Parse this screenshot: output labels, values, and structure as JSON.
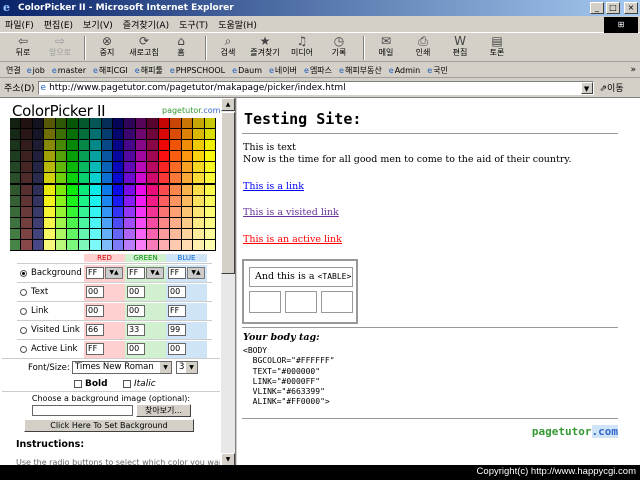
{
  "window": {
    "title": "ColorPicker II - Microsoft Internet Explorer",
    "controls": {
      "min": "_",
      "max": "□",
      "close": "×"
    }
  },
  "menu": [
    "파일(F)",
    "편집(E)",
    "보기(V)",
    "즐겨찾기(A)",
    "도구(T)",
    "도움말(H)"
  ],
  "toolbar": [
    {
      "label": "뒤로",
      "icon": "back-icon",
      "glyph": "⇦",
      "enabled": true
    },
    {
      "label": "앞으로",
      "icon": "forward-icon",
      "glyph": "⇨",
      "enabled": false
    },
    {
      "label": "중지",
      "icon": "stop-icon",
      "glyph": "⊗",
      "enabled": true
    },
    {
      "label": "새로고침",
      "icon": "refresh-icon",
      "glyph": "⟳",
      "enabled": true
    },
    {
      "label": "홈",
      "icon": "home-icon",
      "glyph": "⌂",
      "enabled": true
    },
    {
      "label": "검색",
      "icon": "search-icon",
      "glyph": "⌕",
      "enabled": true
    },
    {
      "label": "즐겨찾기",
      "icon": "favorites-icon",
      "glyph": "★",
      "enabled": true
    },
    {
      "label": "미디어",
      "icon": "media-icon",
      "glyph": "♫",
      "enabled": true
    },
    {
      "label": "기록",
      "icon": "history-icon",
      "glyph": "◷",
      "enabled": true
    },
    {
      "label": "메일",
      "icon": "mail-icon",
      "glyph": "✉",
      "enabled": true
    },
    {
      "label": "인쇄",
      "icon": "print-icon",
      "glyph": "⎙",
      "enabled": true
    },
    {
      "label": "편집",
      "icon": "edit-icon",
      "glyph": "W",
      "enabled": true
    },
    {
      "label": "토론",
      "icon": "discuss-icon",
      "glyph": "▤",
      "enabled": true
    }
  ],
  "links_label": "연결",
  "links": [
    "job",
    "master",
    "해피CGI",
    "해피툴",
    "PHPSCHOOL",
    "Daum",
    "네이버",
    "엠파스",
    "해피부동산",
    "Admin",
    "국민"
  ],
  "links_more": "»",
  "address": {
    "label": "주소(D)",
    "url": "http://www.pagetutor.com/pagetutor/makapage/picker/index.html",
    "go": "⇗이동"
  },
  "picker": {
    "title": "ColorPicker II",
    "brand_a": "pagetutor",
    "brand_b": ".com",
    "headers": {
      "red": "RED",
      "green": "GREEN",
      "blue": "BLUE"
    },
    "rows": [
      {
        "label": "Background",
        "r": "FF",
        "g": "FF",
        "b": "FF",
        "checked": true
      },
      {
        "label": "Text",
        "r": "00",
        "g": "00",
        "b": "00",
        "checked": false
      },
      {
        "label": "Link",
        "r": "00",
        "g": "00",
        "b": "FF",
        "checked": false
      },
      {
        "label": "Visited Link",
        "r": "66",
        "g": "33",
        "b": "99",
        "checked": false
      },
      {
        "label": "Active Link",
        "r": "FF",
        "g": "00",
        "b": "00",
        "checked": false
      }
    ],
    "font_label": "Font/Size:",
    "font_value": "Times New Roman",
    "size_value": "3",
    "bold_label": "Bold",
    "italic_label": "Italic",
    "bg_image_label": "Choose a background image (optional):",
    "browse_label": "찾아보기...",
    "set_bg_label": "Click Here To Set Background",
    "instructions_label": "Instructions:",
    "instructions_text": "Use the radio buttons to select which color you want to change"
  },
  "testing": {
    "title": "Testing Site:",
    "text1": "This is text",
    "text2": "Now is the time for all good men to come to the aid of their country.",
    "link": "This is a link",
    "visited": "This is a visited link",
    "active": "This is an active link",
    "table_text": "And this is a ",
    "table_tag": "<TABLE>",
    "body_heading": "Your body tag:",
    "body_code": "<BODY\n  BGCOLOR=\"#FFFFFF\"\n  TEXT=\"#000000\"\n  LINK=\"#0000FF\"\n  VLINK=\"#663399\"\n  ALINK=\"#FF0000\">",
    "logo_a": "pagetutor",
    "logo_b": ".com"
  },
  "status": {
    "copyright": "Copyright(c) http://www.happycgi.com"
  }
}
